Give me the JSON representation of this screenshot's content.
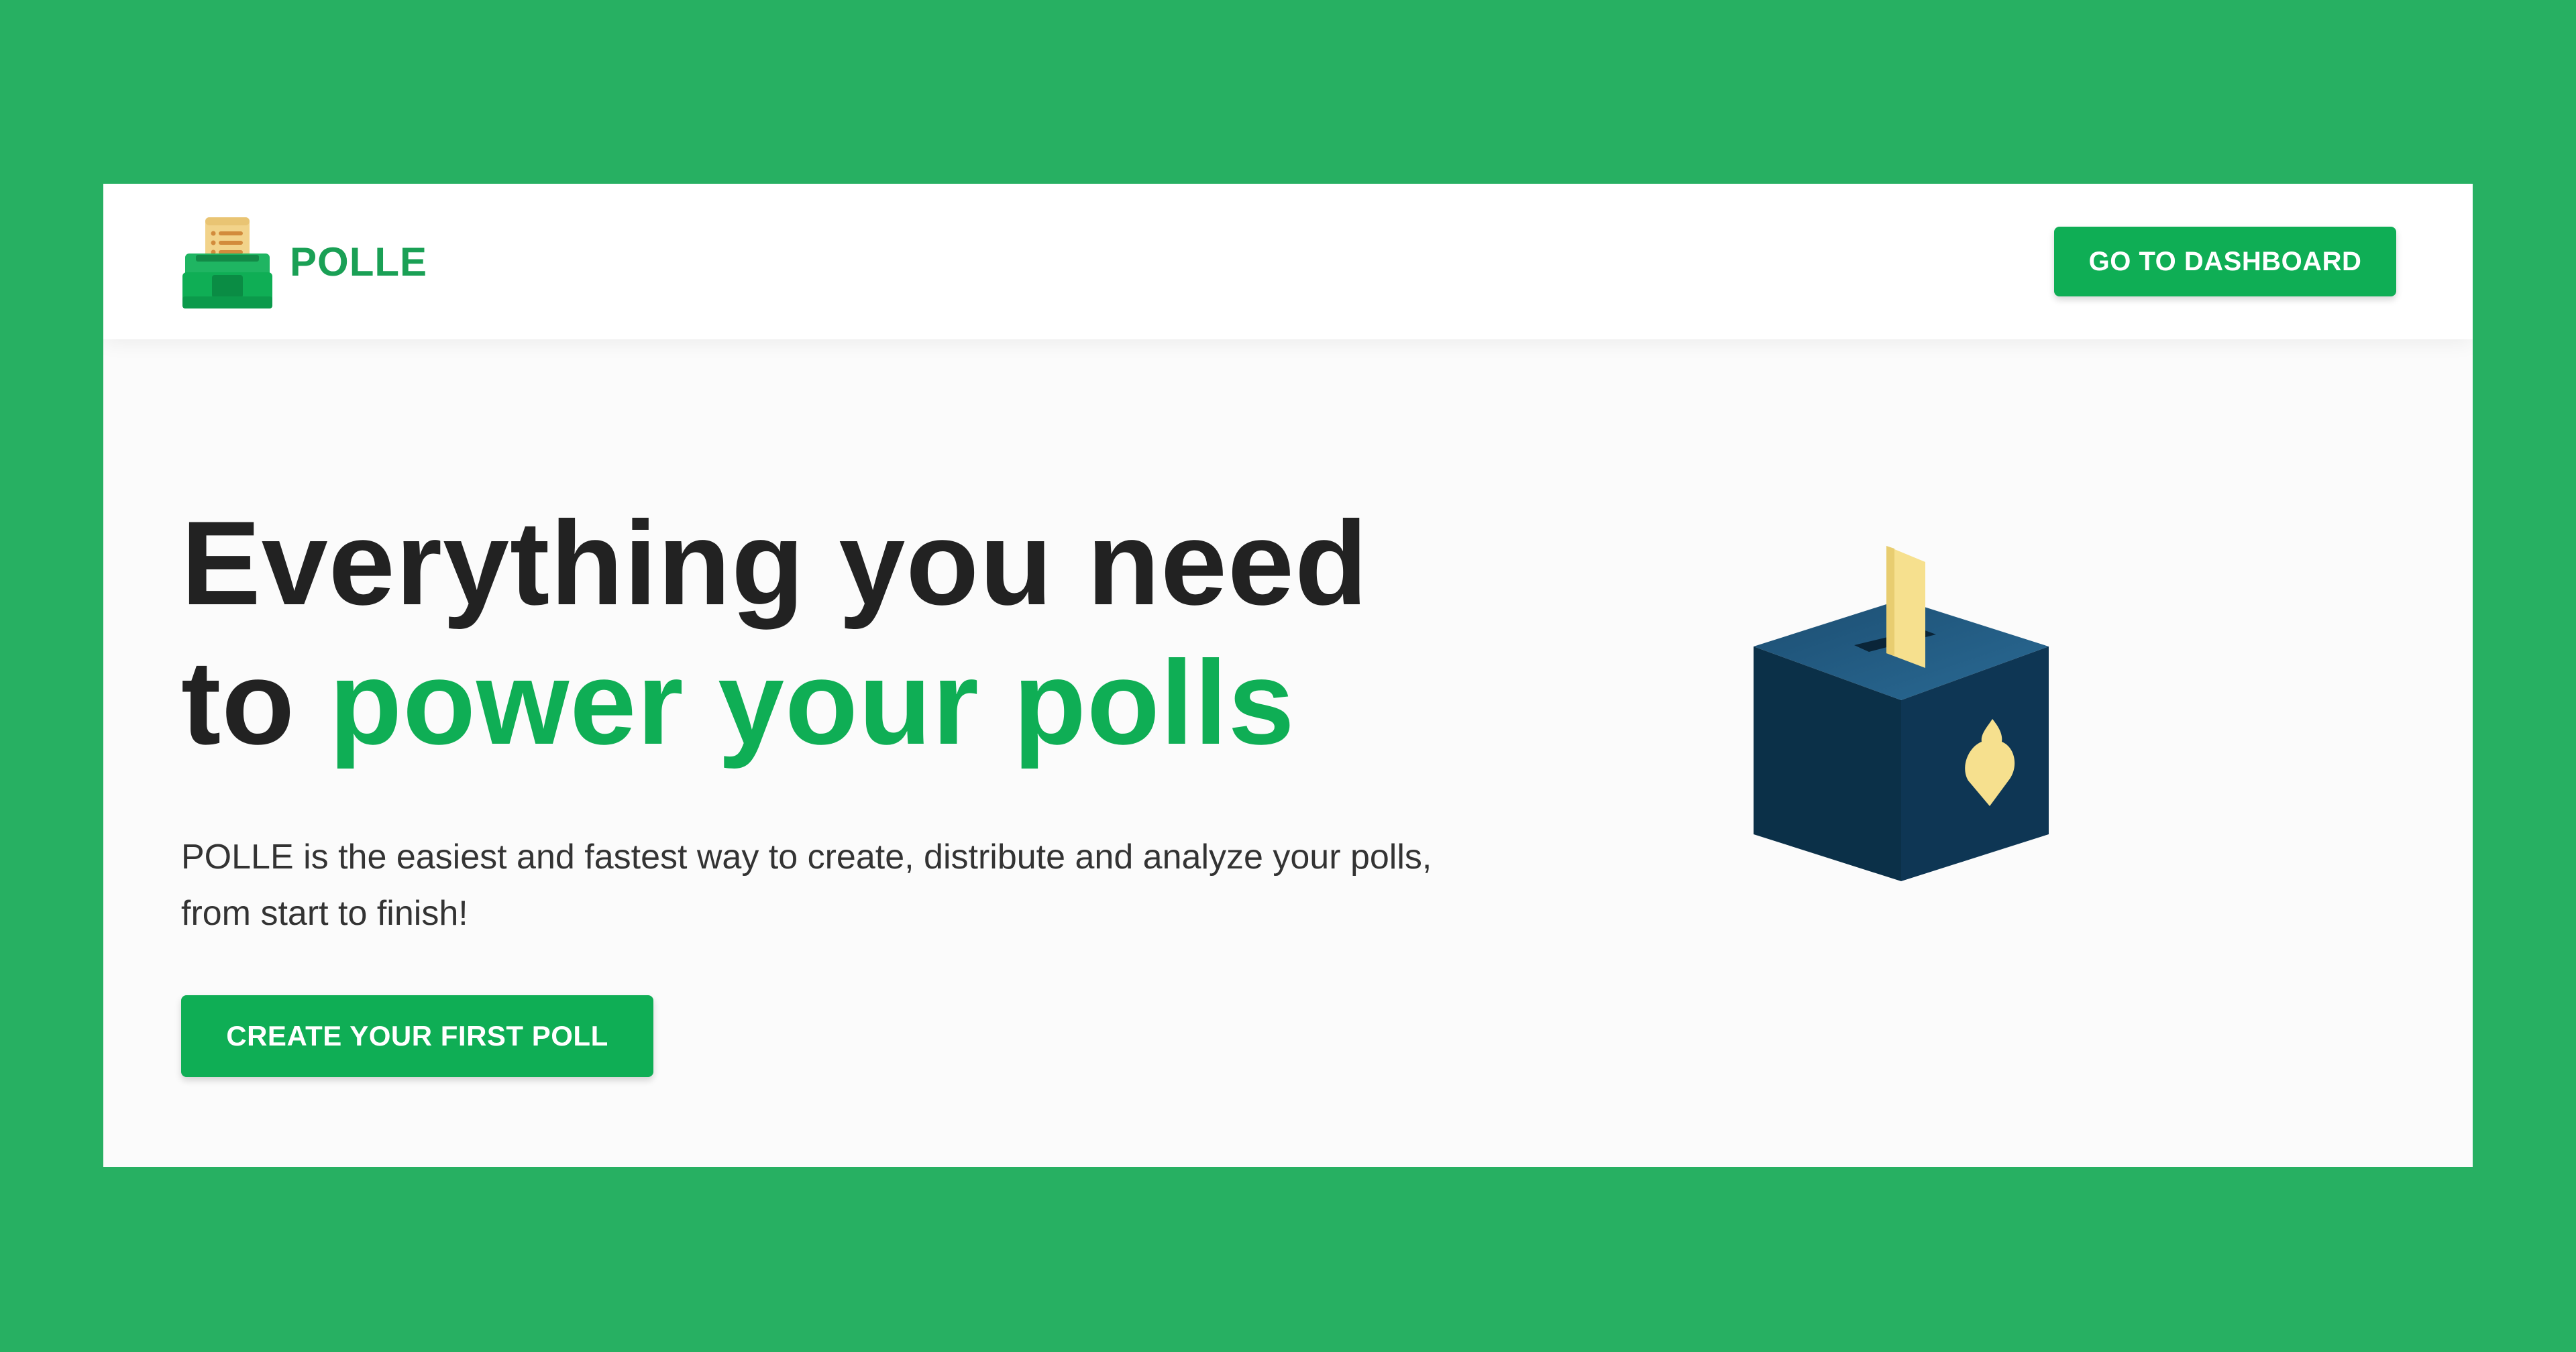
{
  "brand": {
    "name": "POLLE",
    "logo_icon": "ballot-tray-icon",
    "color": "#1aa055"
  },
  "nav": {
    "dashboard_button": "GO TO DASHBOARD"
  },
  "hero": {
    "title_line1": "Everything you need",
    "title_line2_prefix": "to ",
    "title_line2_accent": "power your polls",
    "subtitle": "POLLE is the easiest and fastest way to create, distribute and analyze your polls, from start to finish!",
    "cta_button": "CREATE YOUR FIRST POLL",
    "illustration_icon": "ballot-box-icon"
  },
  "colors": {
    "page_background": "#27b062",
    "accent": "#0fae55",
    "heading": "#222222",
    "box_dark": "#0b3048",
    "paper": "#f6e08e"
  }
}
